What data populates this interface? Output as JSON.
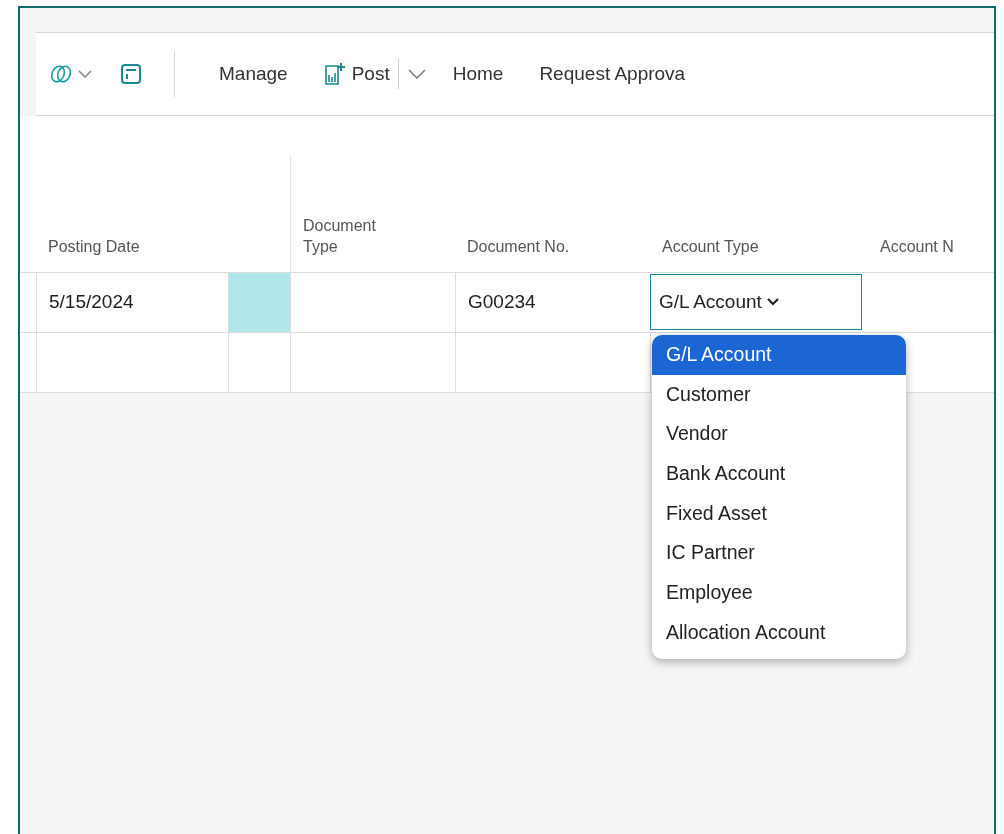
{
  "toolbar": {
    "actions": [
      {
        "kind": "copilot"
      },
      {
        "kind": "layout"
      },
      {
        "kind": "text",
        "label": "Manage"
      },
      {
        "kind": "split",
        "label": "Post"
      },
      {
        "kind": "text",
        "label": "Home"
      },
      {
        "kind": "text",
        "label": "Request Approva"
      }
    ]
  },
  "table": {
    "columns": [
      "Posting Date",
      "Document Type",
      "Document No.",
      "Account Type",
      "Account N"
    ],
    "rows": [
      {
        "posting_date": "5/15/2024",
        "document_no": "G00234",
        "account_type": "G/L Account"
      }
    ]
  },
  "account_type_dropdown": {
    "options": [
      {
        "label": "G/L Account",
        "selected": true
      },
      {
        "label": "Customer",
        "selected": false
      },
      {
        "label": "Vendor",
        "selected": false
      },
      {
        "label": "Bank Account",
        "selected": false
      },
      {
        "label": "Fixed Asset",
        "selected": false
      },
      {
        "label": "IC Partner",
        "selected": false
      },
      {
        "label": "Employee",
        "selected": false
      },
      {
        "label": "Allocation Account",
        "selected": false
      }
    ]
  }
}
